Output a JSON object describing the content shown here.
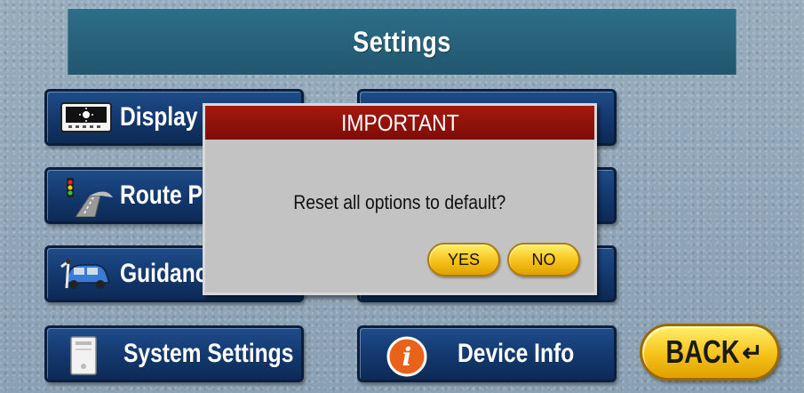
{
  "header": {
    "title": "Settings"
  },
  "menu": {
    "display_label": "Display",
    "route_label": "Route Pr",
    "guidance_label": "Guidanc",
    "system_label": "System Settings",
    "device_label": "Device Info"
  },
  "back": {
    "label": "BACK"
  },
  "dialog": {
    "title": "IMPORTANT",
    "message": "Reset all options to default?",
    "yes_label": "YES",
    "no_label": "NO"
  },
  "colors": {
    "header_bg": "#21566f",
    "menu_btn": "#12366a",
    "dialog_header": "#8e1208",
    "accent_yellow": "#f6c21a"
  },
  "icons": [
    "display-icon",
    "traffic-light-route-icon",
    "guidance-car-icon",
    "system-device-icon",
    "info-icon",
    "return-arrow-icon"
  ]
}
